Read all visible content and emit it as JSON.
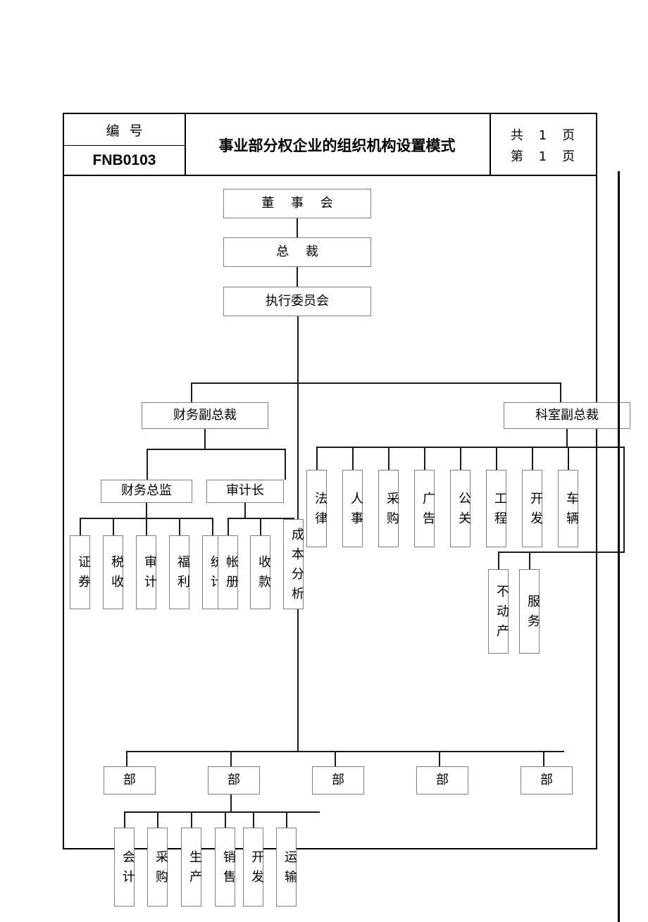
{
  "header": {
    "code_label": "编号",
    "code_value": "FNB0103",
    "title": "事业部分权企业的组织机构设置模式",
    "pages": {
      "total_prefix": "共",
      "total_num": "1",
      "total_suffix": "页",
      "current_prefix": "第",
      "current_num": "1",
      "current_suffix": "页"
    }
  },
  "chart_data": {
    "type": "diagram",
    "title": "事业部分权企业的组织机构设置模式",
    "orientation": "top-down",
    "nodes": {
      "board": "董 事 会",
      "president": "总 裁",
      "exec_committee": "执行委员会",
      "vp_finance": "财务副总裁",
      "vp_office": "科室副总裁",
      "finance_director": "财务总监",
      "auditor_general": "审计长",
      "finance_children": [
        "证券",
        "税收",
        "审计",
        "福利",
        "统计"
      ],
      "audit_children": [
        "帐册",
        "收款",
        "成本分析"
      ],
      "office_children": [
        "法律",
        "人事",
        "采购",
        "广告",
        "公关",
        "工程",
        "开发",
        "车辆"
      ],
      "vehicle_children": [
        "不动产",
        "服务"
      ],
      "divisions": [
        "部",
        "部",
        "部",
        "部",
        "部"
      ],
      "division_children": [
        "会计",
        "采购",
        "生产",
        "销售",
        "开发",
        "运输"
      ]
    }
  }
}
